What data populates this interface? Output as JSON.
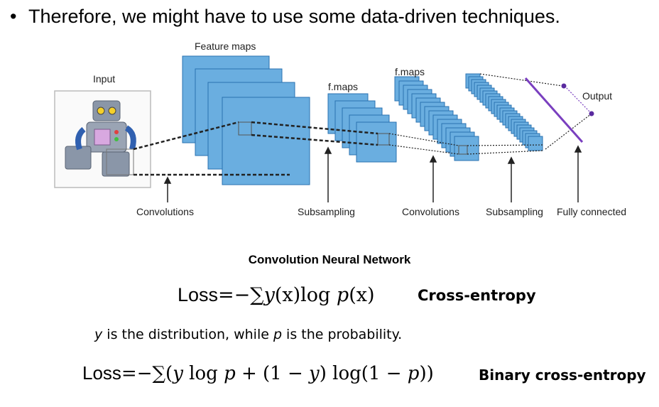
{
  "bullet": {
    "symbol": "•",
    "text": "Therefore, we might have to use some data-driven techniques."
  },
  "diagram": {
    "labels": {
      "input": "Input",
      "feature_maps": "Feature maps",
      "fmaps_1": "f.maps",
      "fmaps_2": "f.maps",
      "output": "Output",
      "convolutions_1": "Convolutions",
      "subsampling_1": "Subsampling",
      "convolutions_2": "Convolutions",
      "subsampling_2": "Subsampling",
      "fully_connected": "Fully connected"
    },
    "caption": "Convolution Neural Network",
    "colors": {
      "map_fill": "#6aaee0",
      "map_stroke": "#2a72b0",
      "output_line": "#7a3fbf"
    }
  },
  "formula_ce": {
    "loss": "Loss",
    "eq": "=−∑",
    "y": "y",
    "x1": "(x)log",
    "p": "p",
    "x2": "(x)",
    "tag": "Cross-entropy"
  },
  "note": {
    "y": "y",
    "mid": " is the distribution, while ",
    "p": "p",
    "end": " is the probability."
  },
  "formula_bce": {
    "loss": "Loss",
    "eq": "=−∑(",
    "y1": "y",
    "log1": " log ",
    "p1": "p",
    "mid": " + (1 − ",
    "y2": "y",
    "mid2": ") log(1 − ",
    "p2": "p",
    "end": "))",
    "tag": "Binary cross-entropy"
  }
}
